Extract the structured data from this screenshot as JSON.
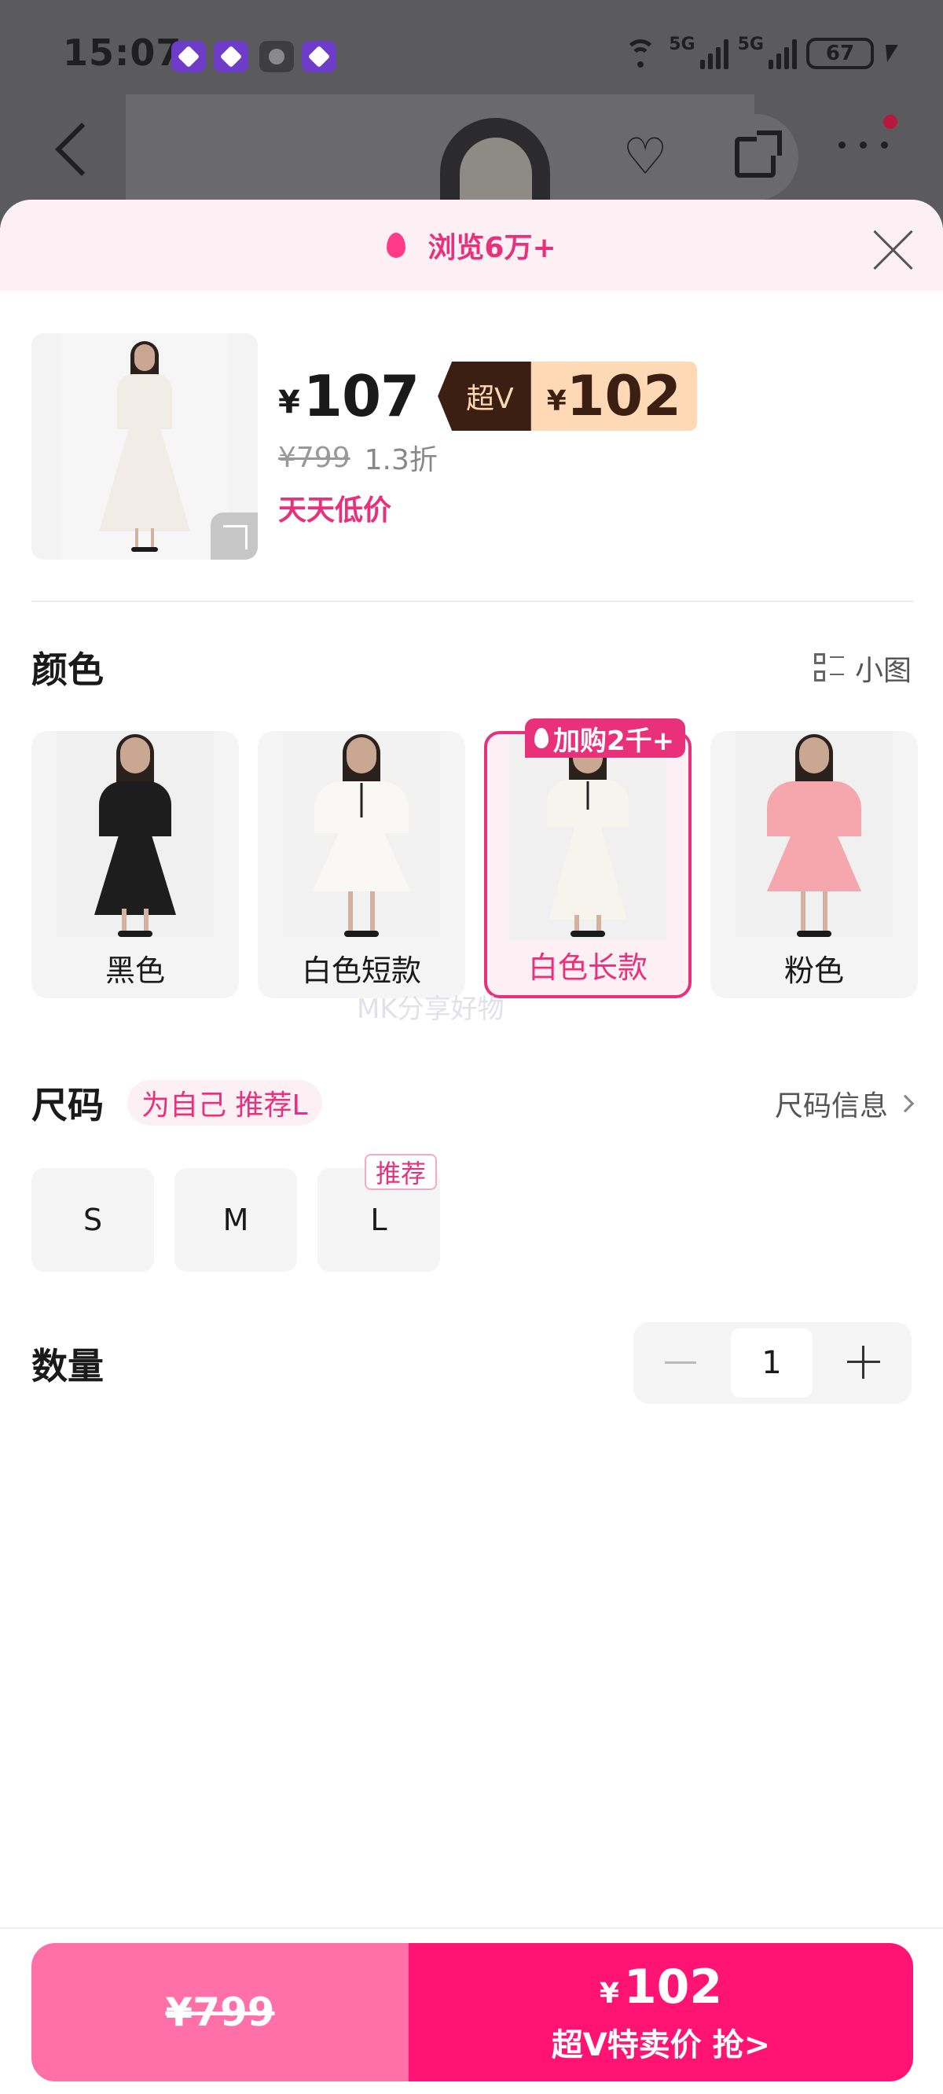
{
  "status_bar": {
    "time": "15:07",
    "network_5g_1": "5G",
    "network_5g_2": "5G",
    "battery": "67"
  },
  "sheet": {
    "views": "浏览6万+"
  },
  "product": {
    "price_currency": "¥",
    "price": "107",
    "vip_label": "超V",
    "vip_currency": "¥",
    "vip_price": "102",
    "original_price": "¥799",
    "discount": "1.3折",
    "promo": "天天低价"
  },
  "color_section": {
    "title": "颜色",
    "view_toggle": "小图",
    "badge": "加购2千+",
    "selected_index": 2,
    "options": [
      {
        "label": "黑色"
      },
      {
        "label": "白色短款"
      },
      {
        "label": "白色长款"
      },
      {
        "label": "粉色"
      }
    ]
  },
  "watermark": "MK分享好物",
  "size_section": {
    "title": "尺码",
    "recommend": "为自己 推荐L",
    "info_link": "尺码信息",
    "recommended_tag": "推荐",
    "options": [
      {
        "label": "S"
      },
      {
        "label": "M"
      },
      {
        "label": "L"
      }
    ]
  },
  "quantity_section": {
    "title": "数量",
    "value": "1"
  },
  "buy_bar": {
    "original_price": "¥799",
    "currency": "¥",
    "price": "102",
    "label": "超V特卖价 抢>"
  },
  "colors": {
    "accent": "#e8317a",
    "buy_left": "#ff6fa8",
    "buy_right": "#ff1473",
    "vip_dark": "#3a1f12",
    "vip_light": "#ffd9b6"
  }
}
